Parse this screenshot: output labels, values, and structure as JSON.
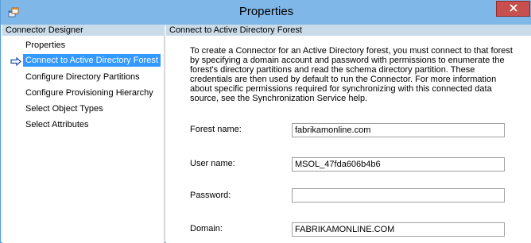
{
  "window": {
    "title": "Properties",
    "app_icon": "app-window-icon",
    "close_icon": "close-icon"
  },
  "left_pane": {
    "header": "Connector Designer",
    "current_indicator_icon": "arrow-right-icon",
    "items": [
      {
        "label": "Properties",
        "selected": false
      },
      {
        "label": "Connect to Active Directory Forest",
        "selected": true
      },
      {
        "label": "Configure Directory Partitions",
        "selected": false
      },
      {
        "label": "Configure Provisioning Hierarchy",
        "selected": false
      },
      {
        "label": "Select Object Types",
        "selected": false
      },
      {
        "label": "Select Attributes",
        "selected": false
      }
    ]
  },
  "right_pane": {
    "header": "Connect to Active Directory Forest",
    "description": "To create a Connector for an Active Directory forest, you must connect to that forest by specifying a domain account and password with permissions to enumerate the forest's directory partitions and read the schema directory partition. These credentials are then used by default to run the Connector. For more information about specific permissions required for synchronizing with this connected data source, see the Synchronization Service help.",
    "fields": {
      "forest_name": {
        "label": "Forest name:",
        "value": "fabrikamonline.com"
      },
      "user_name": {
        "label": "User name:",
        "value": "MSOL_47fda606b4b6"
      },
      "password": {
        "label": "Password:",
        "value": ""
      },
      "domain": {
        "label": "Domain:",
        "value": "FABRIKAMONLINE.COM"
      }
    }
  },
  "colors": {
    "titlebar": "#7fb7e8",
    "pane_header": "#c9dbe9",
    "selection": "#3399ff",
    "close_button": "#c7504f"
  }
}
